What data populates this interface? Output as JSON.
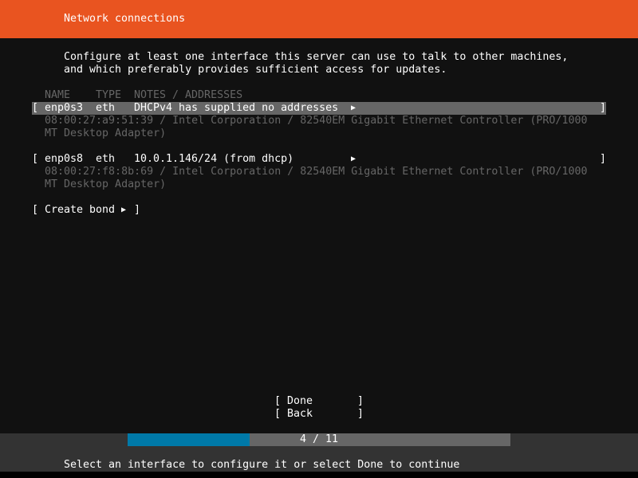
{
  "header": {
    "title": "Network connections",
    "color": "#E95420"
  },
  "intro": {
    "line1": "Configure at least one interface this server can use to talk to other machines,",
    "line2": "and which preferably provides sufficient access for updates."
  },
  "table": {
    "columns": [
      "NAME",
      "TYPE",
      "NOTES / ADDRESSES"
    ],
    "interfaces": [
      {
        "name": "enp0s3",
        "type": "eth",
        "notes": "DHCPv4 has supplied no addresses",
        "detail1": "08:00:27:a9:51:39 / Intel Corporation / 82540EM Gigabit Ethernet Controller (PRO/1000",
        "detail2": "MT Desktop Adapter)",
        "selected": true
      },
      {
        "name": "enp0s8",
        "type": "eth",
        "notes": "10.0.1.146/24 (from dhcp)",
        "detail1": "08:00:27:f8:8b:69 / Intel Corporation / 82540EM Gigabit Ethernet Controller (PRO/1000",
        "detail2": "MT Desktop Adapter)",
        "selected": false
      }
    ],
    "open_bracket": "[",
    "close_bracket": "]",
    "arrow": "▶"
  },
  "create_bond": {
    "label": "Create bond"
  },
  "buttons": {
    "done": "Done",
    "back": "Back"
  },
  "progress": {
    "current": 4,
    "total": 11,
    "text": "4 / 11",
    "fill_color": "#0079A8"
  },
  "status": "Select an interface to configure it or select Done to continue"
}
